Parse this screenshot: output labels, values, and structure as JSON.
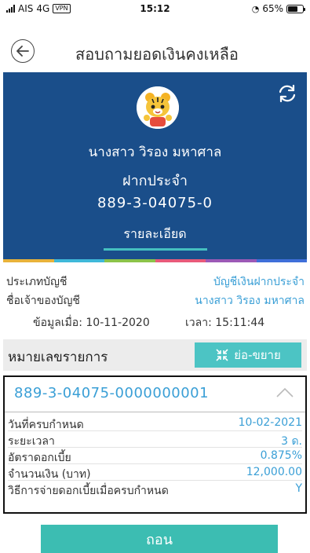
{
  "status_bar": {
    "carrier": "AIS",
    "network": "4G",
    "vpn": "VPN",
    "time": "15:12",
    "battery": "65%",
    "battery_level": 0.65
  },
  "header": {
    "title": "สอบถามยอดเงินคงเหลือ"
  },
  "account": {
    "owner": "นางสาว วิรอง มหาศาล",
    "type": "ฝากประจำ",
    "number": "889-3-04075-0",
    "detail_tab": "รายละเอียด"
  },
  "info": {
    "account_type_label": "ประเภทบัญชี",
    "account_type_value": "บัญชีเงินฝากประจำ",
    "owner_label": "ชื่อเจ้าของบัญชี",
    "owner_value": "นางสาว วิรอง มหาศาล",
    "updated": "ข้อมูลเมื่อ: 10-11-2020",
    "updated_time": "เวลา: 15:11:44"
  },
  "section": {
    "title": "หมายเลขรายการ",
    "toggle_label": "ย่อ-ขยาย"
  },
  "deposit": {
    "id": "889-3-04075-0000000001",
    "rows": [
      {
        "label": "วันที่ครบกำหนด",
        "value": "10-02-2021"
      },
      {
        "label": "ระยะเวลา",
        "value": "3 ด."
      },
      {
        "label": "อัตราดอกเบี้ย",
        "value": "0.875%"
      },
      {
        "label": "จำนวนเงิน (บาท)",
        "value": "12,000.00"
      },
      {
        "label": "วิธีการจ่ายดอกเบี้ยเมื่อครบกำหนด",
        "value": "Y"
      }
    ]
  },
  "actions": {
    "withdraw_label": "ถอน"
  },
  "colors": {
    "banner": "#1a4e8a",
    "accent": "#4cc4c4",
    "link": "#3a9fd6",
    "stripe": [
      "#e8b23a",
      "#3fb8d9",
      "#8bc34a",
      "#e85a7a",
      "#9b59b6",
      "#3f6fd9"
    ]
  }
}
